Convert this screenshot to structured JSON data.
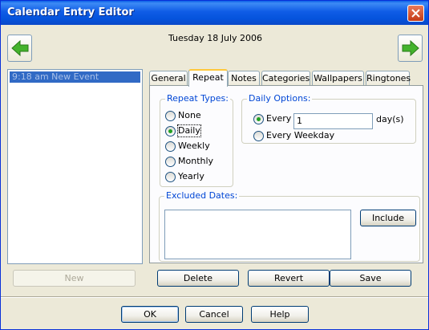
{
  "window": {
    "title": "Calendar Entry Editor"
  },
  "header": {
    "date": "Tuesday 18 July 2006"
  },
  "events": [
    {
      "label": "9:18 am New Event"
    }
  ],
  "buttons": {
    "new": "New",
    "delete": "Delete",
    "revert": "Revert",
    "save": "Save",
    "include": "Include",
    "ok": "OK",
    "cancel": "Cancel",
    "help": "Help"
  },
  "tabs": [
    "General",
    "Repeat",
    "Notes",
    "Categories",
    "Wallpapers",
    "Ringtones"
  ],
  "active_tab": "Repeat",
  "repeat_types": {
    "title": "Repeat Types:",
    "options": [
      "None",
      "Daily",
      "Weekly",
      "Monthly",
      "Yearly"
    ],
    "selected": "Daily"
  },
  "daily_options": {
    "title": "Daily Options:",
    "every_label": "Every",
    "every_value": "1",
    "unit": "day(s)",
    "weekday_label": "Every Weekday",
    "selected": "Every"
  },
  "excluded_dates": {
    "title": "Excluded Dates:"
  },
  "colors": {
    "accent": "#0046d5",
    "selection": "#316ac5",
    "titlebar": "#0553dc"
  }
}
